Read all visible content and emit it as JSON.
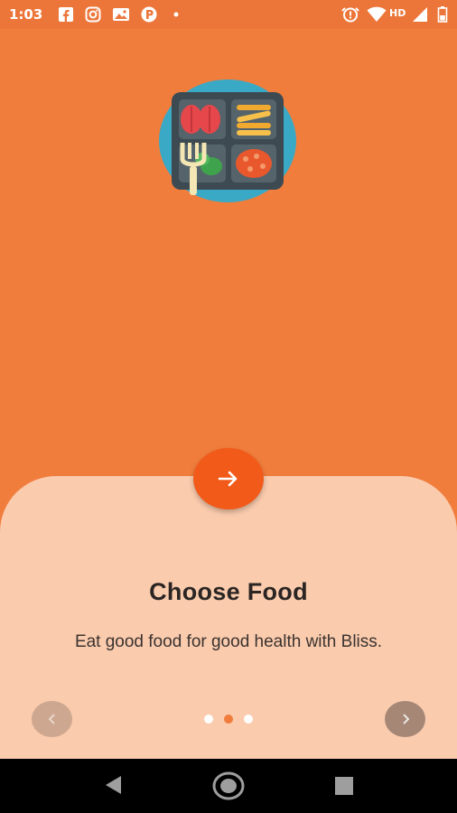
{
  "status_bar": {
    "time": "1:03",
    "network_label": "HD",
    "left_icons": [
      "facebook-icon",
      "instagram-icon",
      "photos-icon",
      "pandora-icon",
      "dot-icon"
    ],
    "right_icons": [
      "alarm-icon",
      "wifi-icon",
      "signal-icon",
      "battery-icon"
    ]
  },
  "onboarding": {
    "illustration": "lunch-tray-illustration",
    "title": "Choose Food",
    "description": "Eat good food for good health with Bliss.",
    "next_icon": "arrow-right-icon",
    "pager": {
      "total": 3,
      "active": 2
    },
    "prev_icon": "chevron-left-icon",
    "forward_icon": "chevron-right-icon"
  },
  "colors": {
    "background": "#F07D3C",
    "sheet": "#FACBAD",
    "accent": "#F25A1A",
    "dot_active": "#F07D3C",
    "dot_inactive": "#FFFFFF",
    "text_primary": "#2A2523"
  },
  "system_nav": [
    "back-icon",
    "home-icon",
    "recents-icon"
  ]
}
